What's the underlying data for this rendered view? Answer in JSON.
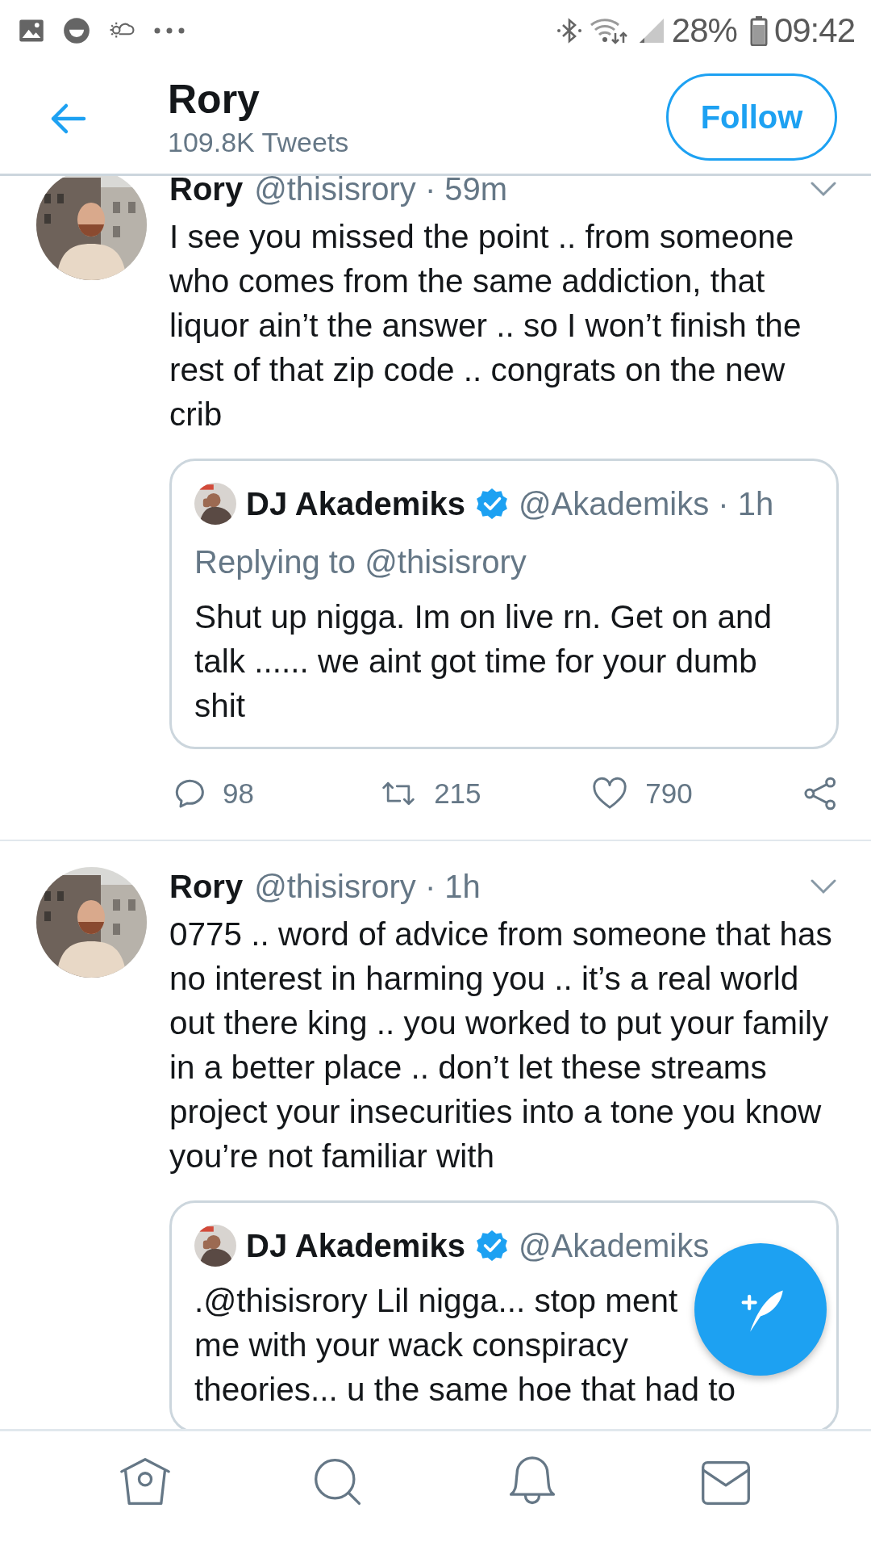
{
  "status_bar": {
    "battery": "28%",
    "time": "09:42"
  },
  "header": {
    "name": "Rory",
    "subtitle": "109.8K Tweets",
    "follow_button": "Follow"
  },
  "tweets": [
    {
      "name": "Rory",
      "meta": "@thisisrory · 59m",
      "text": "I see you missed the point .. from someone who comes from the same addiction, that liquor ain’t the answer .. so I won’t finish the rest of that zip code .. congrats on the new crib",
      "quote": {
        "name": "DJ Akademiks",
        "verified": true,
        "meta": "@Akademiks · 1h",
        "replying_to": "Replying to @thisisrory",
        "lines": [
          "Shut up nigga. Im on live rn. Get on and",
          "talk ...... we aint got time for your dumb",
          "shit"
        ]
      },
      "actions": {
        "replies": "98",
        "retweets": "215",
        "likes": "790"
      }
    },
    {
      "name": "Rory",
      "meta": "@thisisrory · 1h",
      "text": "0775 .. word of advice from someone that has no interest in harming you .. it’s a real world out there king .. you worked to put your family in a better place .. don’t let these streams project your insecurities into a tone you know you’re not familiar with",
      "quote": {
        "name": "DJ Akademiks",
        "verified": true,
        "meta": "@Akademiks",
        "lines": [
          ".@thisisrory Lil nigga... stop ment",
          "me with your wack conspiracy",
          "theories... u the same hoe that had to"
        ]
      }
    }
  ]
}
